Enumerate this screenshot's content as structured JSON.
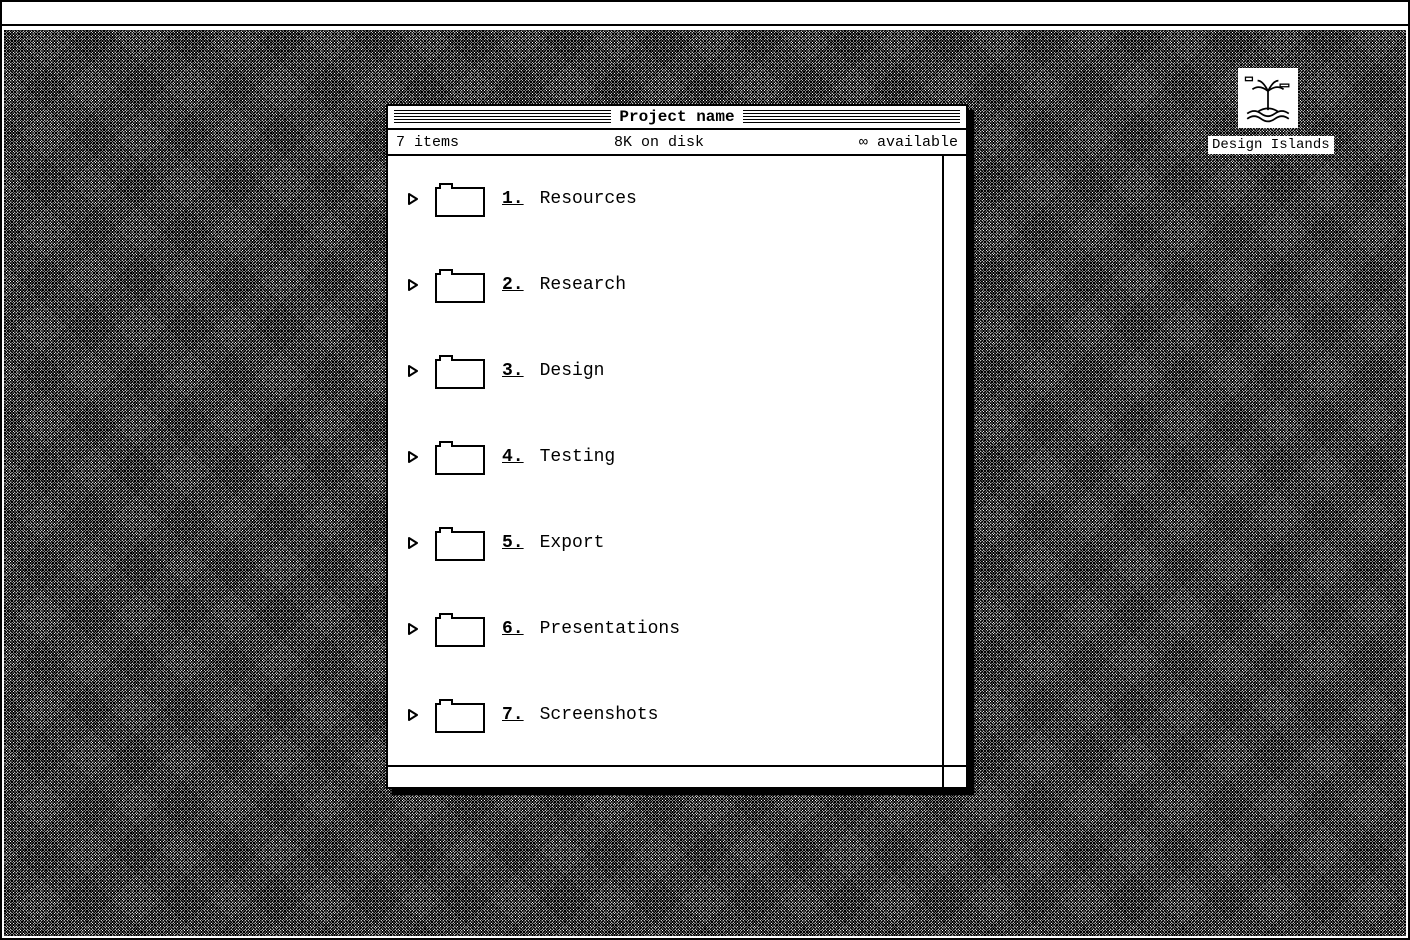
{
  "desktop": {
    "volume": {
      "label": "Design Islands"
    }
  },
  "window": {
    "title": "Project name",
    "status": {
      "items": "7 items",
      "disk": "8K on disk",
      "available": "∞ available"
    },
    "folders": [
      {
        "num": "1.",
        "name": "Resources"
      },
      {
        "num": "2.",
        "name": "Research"
      },
      {
        "num": "3.",
        "name": "Design"
      },
      {
        "num": "4.",
        "name": "Testing"
      },
      {
        "num": "5.",
        "name": "Export"
      },
      {
        "num": "6.",
        "name": "Presentations"
      },
      {
        "num": "7.",
        "name": "Screenshots"
      }
    ]
  }
}
